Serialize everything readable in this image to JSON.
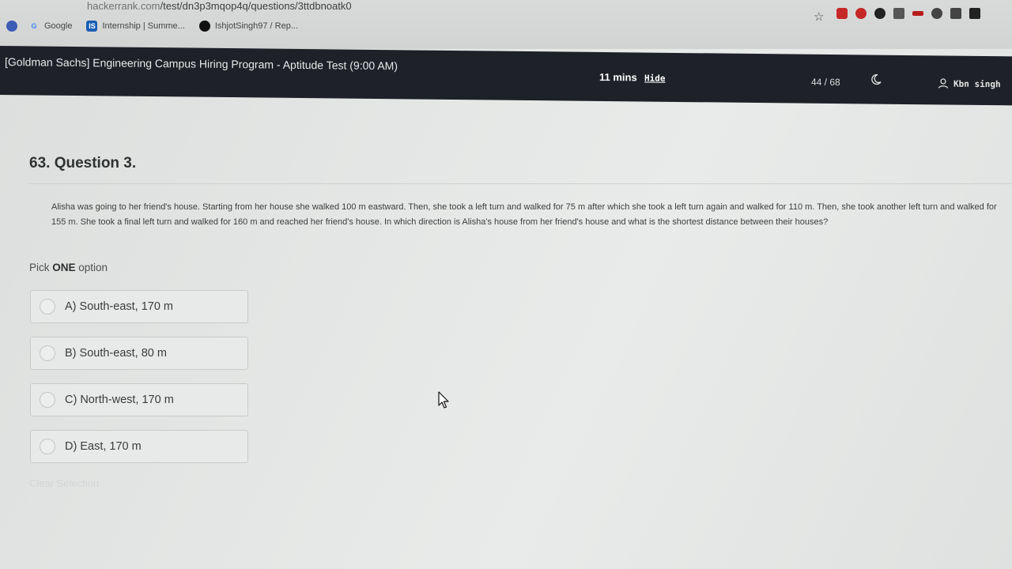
{
  "browser": {
    "address_host": "hackerrank.com",
    "address_path": "/test/dn3p3mqop4q/questions/3ttdbnoatk0",
    "bookmarks": [
      {
        "label": "Google",
        "icon": "google-icon"
      },
      {
        "label": "Internship | Summe...",
        "icon": "is-icon"
      },
      {
        "label": "IshjotSingh97 / Rep...",
        "icon": "github-icon"
      }
    ],
    "extension_colors": [
      "#c62828",
      "#c62828",
      "#222222",
      "#555555",
      "#b71c1c",
      "#444444",
      "#444444",
      "#222222"
    ]
  },
  "header": {
    "title": "[Goldman Sachs] Engineering Campus Hiring Program - Aptitude Test (9:00 AM)",
    "timer": "11 mins",
    "hide_label": "Hide",
    "progress": "44 / 68",
    "user_name": "Kbn singh",
    "background": "#1e2128"
  },
  "question": {
    "title": "63. Question 3.",
    "text": "Alisha was going to her friend's house. Starting from her house she walked 100 m eastward. Then, she took a left turn and walked for 75 m after which she took a left turn again and walked for 110 m. Then, she took another left turn and walked for 155 m. She took a final left turn and walked for 160 m and reached her friend's house. In which direction is Alisha's house from her friend's house and what is the shortest distance between their houses?",
    "pick_prefix": "Pick ",
    "pick_bold": "ONE",
    "pick_suffix": " option",
    "options": [
      {
        "label": "A) South-east, 170 m"
      },
      {
        "label": "B) South-east, 80 m"
      },
      {
        "label": "C) North-west, 170 m"
      },
      {
        "label": "D) East, 170 m"
      }
    ],
    "clear_label": "Clear Selection"
  }
}
